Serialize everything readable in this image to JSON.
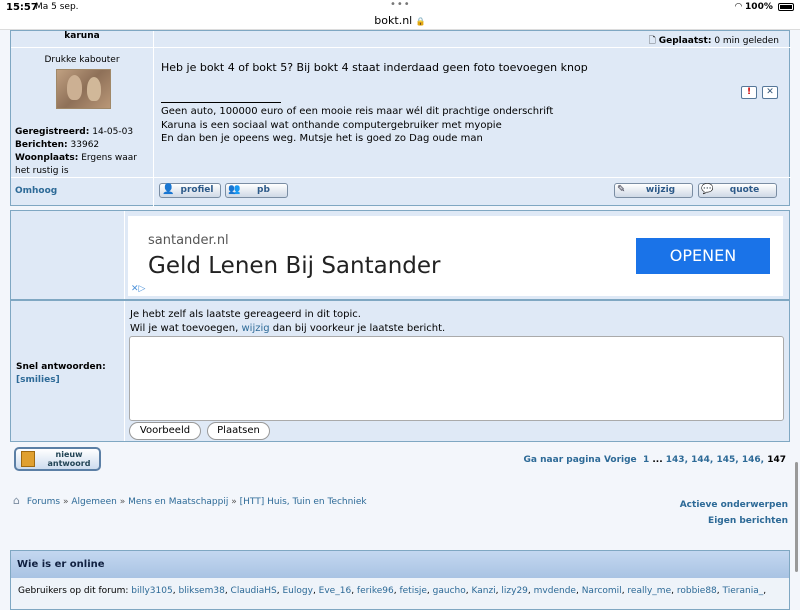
{
  "status_bar": {
    "time": "15:57",
    "date": "Ma 5 sep.",
    "url": "bokt.nl",
    "battery": "100%"
  },
  "post": {
    "author": "karuna",
    "posted_label": "Geplaatst:",
    "posted_value": "0 min geleden",
    "rank": "Drukke kabouter",
    "registered_label": "Geregistreerd:",
    "registered_value": "14-05-03",
    "posts_label": "Berichten:",
    "posts_value": "33962",
    "location_label": "Woonplaats:",
    "location_value": "Ergens waar het rustig is",
    "text": "Heb je bokt 4 of bokt 5? Bij bokt 4 staat inderdaad geen foto toevoegen knop",
    "signature": [
      "Geen auto, 100000 euro of een mooie reis maar wél dit prachtige onderschrift",
      "Karuna is een sociaal wat onthande computergebruiker met myopie",
      "En dan ben je opeens weg. Mutsje het is goed zo Dag oude man"
    ],
    "omhoog": "Omhoog",
    "btn_profiel": "profiel",
    "btn_pb": "pb",
    "btn_wijzig": "wijzig",
    "btn_quote": "quote"
  },
  "ad": {
    "host": "santander.nl",
    "title": "Geld Lenen Bij Santander",
    "cta": "OPENEN"
  },
  "reply": {
    "notice_line1": "Je hebt zelf als laatste gereageerd in dit topic.",
    "notice_pre": "Wil je wat toevoegen, ",
    "notice_link": "wijzig",
    "notice_post": " dan bij voorkeur je laatste bericht.",
    "label": "Snel antwoorden:",
    "smilies": "[smilies]",
    "preview": "Voorbeeld",
    "submit": "Plaatsen"
  },
  "new_reply": {
    "line1": "nieuw",
    "line2": "antwoord"
  },
  "pagination": {
    "label": "Ga naar pagina",
    "prev": "Vorige",
    "first": "1",
    "ellipsis": "...",
    "pages": [
      "143",
      "144",
      "145",
      "146"
    ],
    "current": "147"
  },
  "breadcrumb": [
    "Forums",
    "Algemeen",
    "Mens en Maatschappij",
    "[HTT] Huis, Tuin en Techniek"
  ],
  "side_links": {
    "active": "Actieve onderwerpen",
    "own": "Eigen berichten"
  },
  "online": {
    "title": "Wie is er online",
    "label": "Gebruikers op dit forum:",
    "users": [
      "billy3105",
      "bliksem38",
      "ClaudiaHS",
      "Eulogy",
      "Eve_16",
      "ferike96",
      "fetisje",
      "gaucho",
      "Kanzi",
      "lizy29",
      "mvdende",
      "Narcomil",
      "really_me",
      "robbie88",
      "Tierania_"
    ]
  }
}
